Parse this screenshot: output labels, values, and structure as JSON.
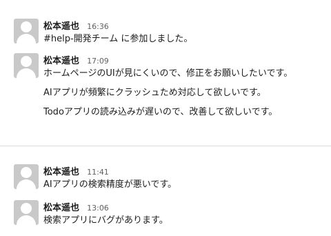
{
  "messages": [
    {
      "sender": "松本遥也",
      "time": "16:36",
      "lines": [
        "#help-開発チーム に参加しました。"
      ]
    },
    {
      "sender": "松本遥也",
      "time": "17:09",
      "lines": [
        "ホームページのUIが見にくいので、修正をお願いしたいです。",
        "AIアプリが頻繁にクラッシュため対応して欲しいです。",
        "Todoアプリの読み込みが遅いので、改善して欲しいです。"
      ]
    },
    {
      "sender": "松本遥也",
      "time": "11:41",
      "lines": [
        "AIアプリの検索精度が悪いです。"
      ]
    },
    {
      "sender": "松本遥也",
      "time": "13:06",
      "lines": [
        "検索アプリにバグがあります。"
      ]
    }
  ]
}
